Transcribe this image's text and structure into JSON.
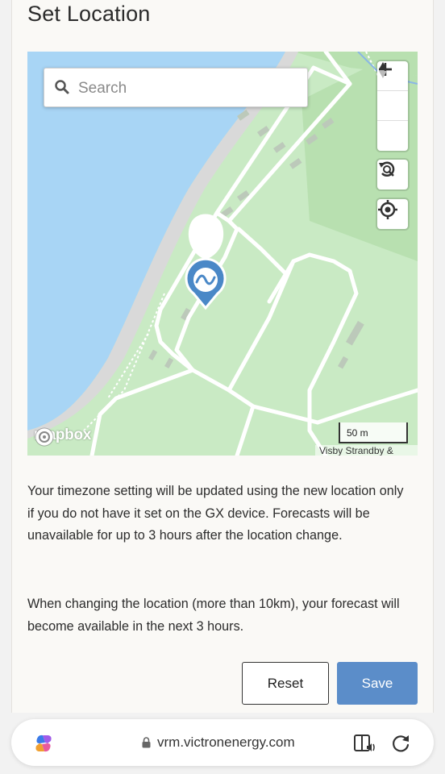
{
  "page": {
    "title": "Set Location"
  },
  "map": {
    "search_placeholder": "Search",
    "logo_text": "mapbox",
    "scale_label": "50 m",
    "attribution": "Visby Strandby &"
  },
  "info": {
    "paragraph1": "Your timezone setting will be updated using the new location only if you do not have it set on the GX device. Forecasts will be unavailable for up to 3 hours after the location change.",
    "paragraph2": "When changing the location (more than 10km), your forecast will become available in the next 3 hours."
  },
  "actions": {
    "reset_label": "Reset",
    "save_label": "Save"
  },
  "browser": {
    "url": "vrm.victronenergy.com"
  },
  "colors": {
    "accent": "#5b8dc9",
    "water": "#a8d5f5",
    "land": "#c9eac4",
    "marker": "#4a88c7"
  }
}
